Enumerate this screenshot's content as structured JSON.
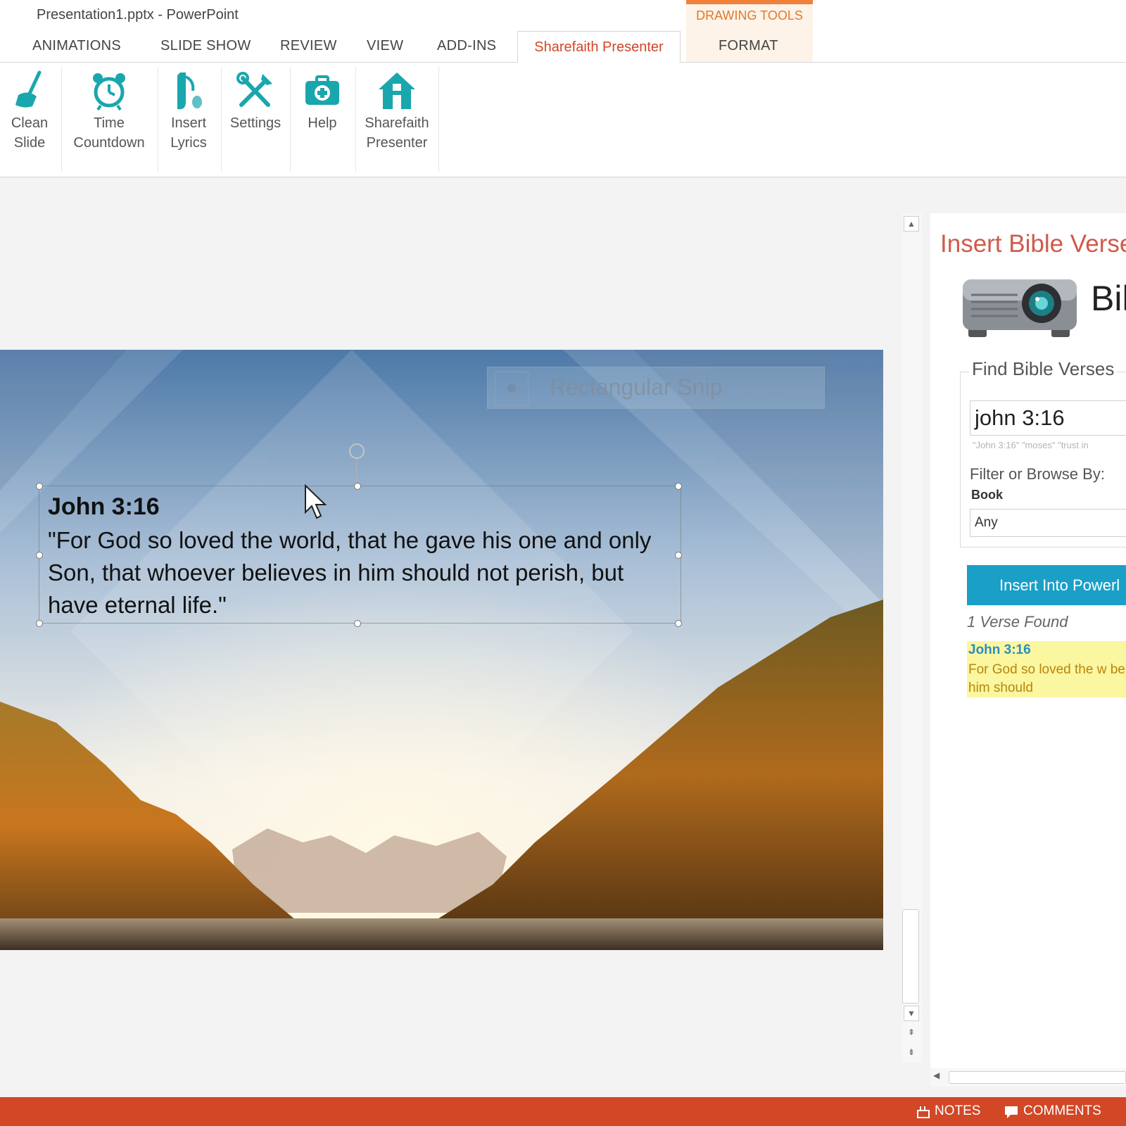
{
  "window": {
    "title": "Presentation1.pptx - PowerPoint"
  },
  "ribbon_tabs": {
    "contextual_group": "DRAWING TOOLS",
    "animations": "ANIMATIONS",
    "slide_show": "SLIDE SHOW",
    "review": "REVIEW",
    "view": "VIEW",
    "add_ins": "ADD-INS",
    "active": "Sharefaith Presenter",
    "format": "FORMAT"
  },
  "ribbon": {
    "clean_slide": "Clean Slide",
    "time_countdown": "Time Countdown",
    "insert_lyrics": "Insert Lyrics",
    "settings": "Settings",
    "help": "Help",
    "sharefaith_presenter": "Sharefaith Presenter"
  },
  "slide": {
    "snip_label": "Rectangular Snip",
    "verse_ref": "John 3:16",
    "verse_text": "\"For God so loved the world, that he gave his one and only Son, that whoever believes in him should not perish, but have eternal life.\""
  },
  "pane": {
    "title": "Insert Bible Verse",
    "logo_text": "Bil",
    "find_label": "Find Bible Verses",
    "search_value": "john 3:16",
    "search_hint": "\"John 3:16\"  \"moses\"  \"trust in",
    "filter_label": "Filter or Browse By:",
    "book_label": "Book",
    "book_value": "Any",
    "insert_button": "Insert Into Powerl",
    "found_count": "1 Verse Found",
    "result_ref": "John 3:16",
    "result_text": "For God so loved the w believes in him should"
  },
  "statusbar": {
    "notes": "NOTES",
    "comments": "COMMENTS"
  },
  "colors": {
    "accent": "#d24726",
    "teal_icons": "#1aa6ad",
    "insert_button": "#1a9fc7",
    "result_highlight": "#fbf6a0"
  }
}
